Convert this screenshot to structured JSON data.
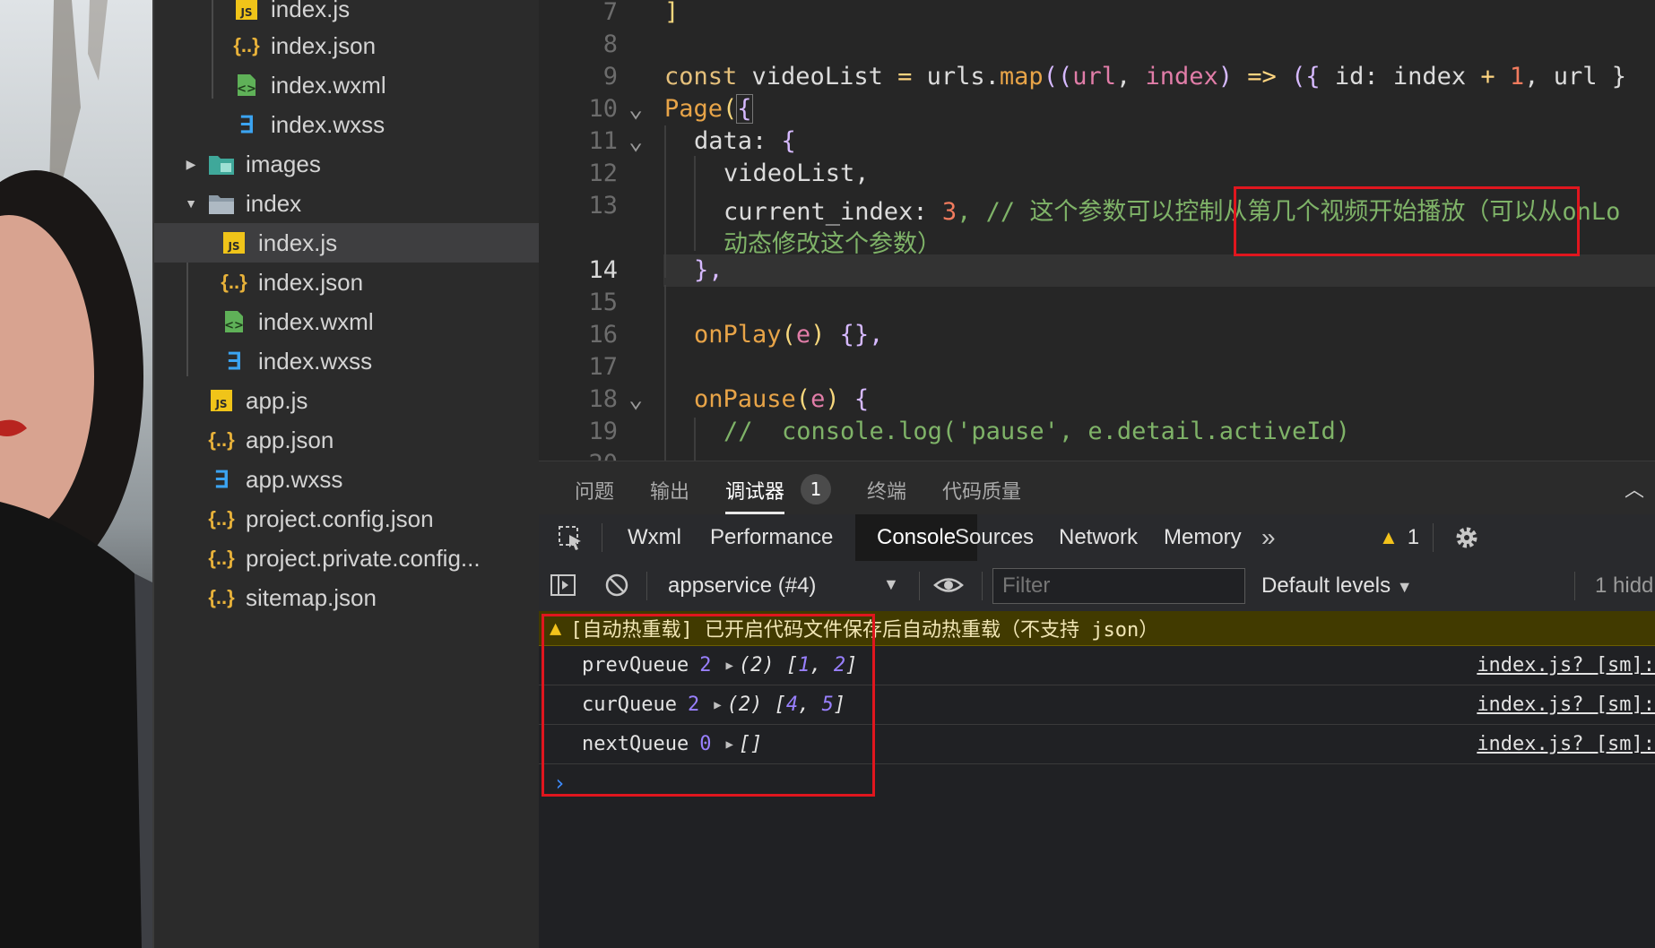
{
  "tree": {
    "items": [
      {
        "label": "index.js",
        "icon": "js-file-icon"
      },
      {
        "label": "index.json",
        "icon": "json-file-icon"
      },
      {
        "label": "index.wxml",
        "icon": "wxml-file-icon"
      },
      {
        "label": "index.wxss",
        "icon": "wxss-file-icon"
      },
      {
        "label": "images",
        "icon": "folder-images-icon"
      },
      {
        "label": "index",
        "icon": "folder-icon"
      },
      {
        "label": "index.js",
        "icon": "js-file-icon"
      },
      {
        "label": "index.json",
        "icon": "json-file-icon"
      },
      {
        "label": "index.wxml",
        "icon": "wxml-file-icon"
      },
      {
        "label": "index.wxss",
        "icon": "wxss-file-icon"
      },
      {
        "label": "app.js",
        "icon": "js-file-icon"
      },
      {
        "label": "app.json",
        "icon": "json-file-icon"
      },
      {
        "label": "app.wxss",
        "icon": "wxss-file-icon"
      },
      {
        "label": "project.config.json",
        "icon": "json-file-icon"
      },
      {
        "label": "project.private.config...",
        "icon": "json-file-icon"
      },
      {
        "label": "sitemap.json",
        "icon": "json-file-icon"
      }
    ]
  },
  "editor": {
    "line_numbers": [
      "7",
      "8",
      "9",
      "10",
      "11",
      "12",
      "13",
      "",
      "14",
      "15",
      "16",
      "17",
      "18",
      "19",
      "20"
    ],
    "current_line": "14",
    "lines": {
      "l7": "]",
      "l9_a": "const",
      "l9_b": " videoList ",
      "l9_c": "=",
      "l9_d": " urls.",
      "l9_e": "map",
      "l9_f": "((",
      "l9_g": "url",
      "l9_h": ", ",
      "l9_i": "index",
      "l9_j": ") ",
      "l9_k": "=>",
      "l9_l": " ({ ",
      "l9_m": "id: index ",
      "l9_n": "+",
      "l9_o": " 1",
      "l9_p": ", url }",
      "l10_a": "Page",
      "l10_b": "(",
      "l10_c": "{",
      "l11_a": "data: ",
      "l11_b": "{",
      "l12": "videoList,",
      "l13_a": "current_index: ",
      "l13_b": "3",
      "l13_c": ", // ",
      "l13_d": "这个参数可以控制从第几个视频开始播放（可以从onLo",
      "l13_wrap": "动态修改这个参数）",
      "l14": "},",
      "l16_a": "onPlay",
      "l16_b": "(",
      "l16_c": "e",
      "l16_d": ") ",
      "l16_e": "{},",
      "l18_a": "onPause",
      "l18_b": "(",
      "l18_c": "e",
      "l18_d": ") ",
      "l18_e": "{",
      "l19_a": "//  console.log(",
      "l19_b": "'pause'",
      "l19_c": ", e.detail.activeId)"
    }
  },
  "panel_tabs": {
    "problems": "问题",
    "output": "输出",
    "debugger": "调试器",
    "debugger_badge": "1",
    "terminal": "终端",
    "code_quality": "代码质量"
  },
  "devtools_tabs": {
    "wxml": "Wxml",
    "performance": "Performance",
    "console": "Console",
    "sources": "Sources",
    "network": "Network",
    "memory": "Memory",
    "more": "»",
    "warnings_count": "1"
  },
  "console_toolbar": {
    "context": "appservice (#4)",
    "filter_placeholder": "Filter",
    "levels": "Default levels",
    "hidden": "1 hidd"
  },
  "console": {
    "warning": "[自动热重载] 已开启代码文件保存后自动热重载（不支持 json）",
    "rows": [
      {
        "key": "prevQueue",
        "num": "2",
        "len": "(2)",
        "open": " [",
        "v1": "1",
        "sep": ", ",
        "v2": "2",
        "close": "]",
        "src": "index.js? [sm]:"
      },
      {
        "key": "curQueue",
        "num": "2",
        "len": "(2)",
        "open": " [",
        "v1": "4",
        "sep": ", ",
        "v2": "5",
        "close": "]",
        "src": "index.js? [sm]:"
      },
      {
        "key": "nextQueue",
        "num": "0",
        "len": "[]",
        "src": "index.js? [sm]:"
      }
    ],
    "prompt": "›"
  },
  "colors": {
    "highlight_box": "#e0161e",
    "warning_bg": "#413a00",
    "console_number": "#9980ff"
  }
}
